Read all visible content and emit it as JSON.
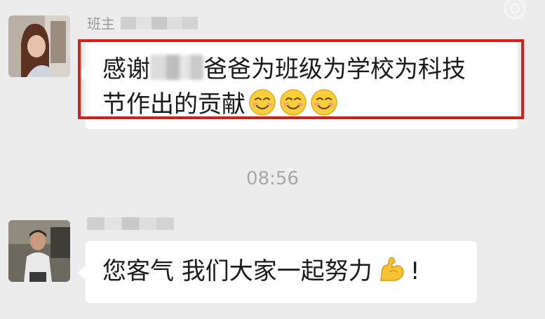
{
  "messages": [
    {
      "sender": "班主",
      "text_before": "感谢",
      "text_after_line1": "爸爸为班级为学校为科技",
      "text_line2": "节作出的贡献",
      "emoji_count": 3,
      "emoji": "smiling-face-icon",
      "highlighted": true
    },
    {
      "text": "您客气 我们大家一起努力",
      "emoji": "flexed-biceps-icon",
      "text_end": "!"
    }
  ],
  "timestamp": "08:56",
  "colors": {
    "background": "#ececec",
    "bubble": "#ffffff",
    "highlight": "#d0211c",
    "timestamp": "#a8a8a8",
    "name": "#9a9a9a"
  },
  "watermark_icon": "weibo-logo-icon"
}
